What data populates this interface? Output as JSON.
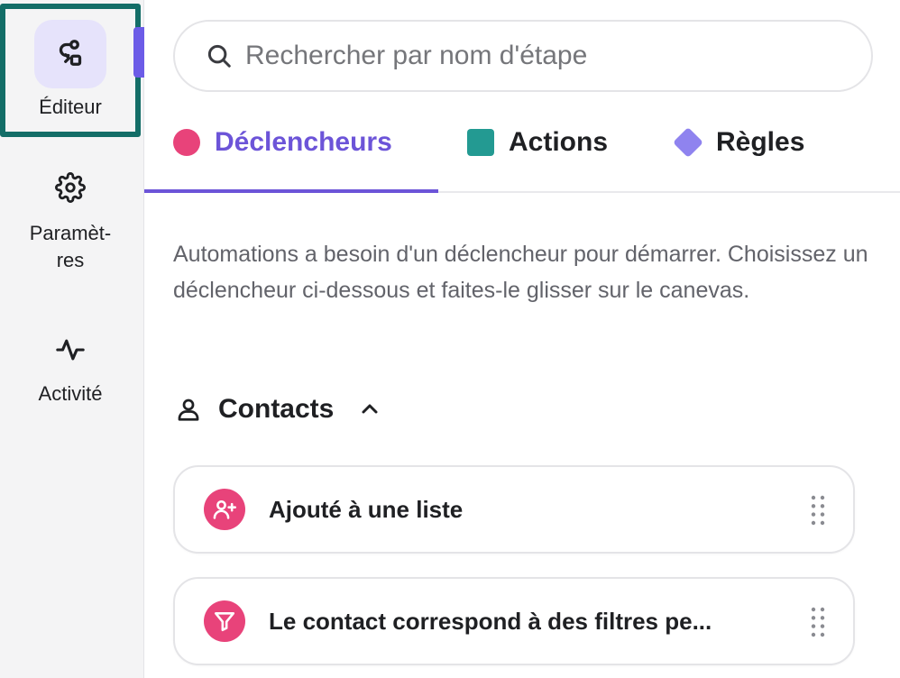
{
  "sidebar": {
    "items": [
      {
        "label": "Éditeur",
        "icon": "workflow-icon",
        "active": true
      },
      {
        "label": "Paramèt-\nres",
        "icon": "gear-icon",
        "active": false
      },
      {
        "label": "Activité",
        "icon": "activity-icon",
        "active": false
      }
    ]
  },
  "search": {
    "placeholder": "Rechercher par nom d'étape",
    "value": "",
    "icon": "search-icon"
  },
  "tabs": [
    {
      "label": "Déclencheurs",
      "marker": "circle",
      "color": "#e8437a",
      "active": true
    },
    {
      "label": "Actions",
      "marker": "square",
      "color": "#239a92",
      "active": false
    },
    {
      "label": "Règles",
      "marker": "diamond",
      "color": "#8f83ef",
      "active": false
    }
  ],
  "description": "Automations a besoin d'un déclencheur pour démarrer. Choisissez un déclencheur ci-dessous et faites-le glisser sur le canevas.",
  "section": {
    "title": "Contacts",
    "icon": "person-icon",
    "expanded": true
  },
  "triggers": [
    {
      "label": "Ajouté à une liste",
      "icon": "user-plus-icon"
    },
    {
      "label": "Le contact correspond à des filtres pe...",
      "icon": "filter-icon"
    }
  ],
  "colors": {
    "accent": "#6c54d8",
    "trigger": "#e8437a",
    "action": "#239a92",
    "rule": "#8f83ef",
    "focus_outline": "#136d67"
  }
}
